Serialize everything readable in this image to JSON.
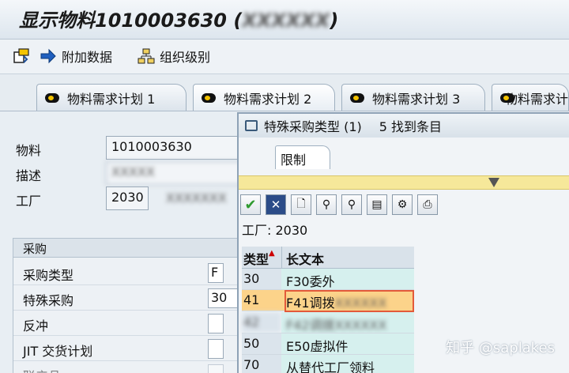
{
  "window": {
    "title": "显示物料1010003630 (",
    "title_blurred": "XXXXXX",
    "title_close": ")"
  },
  "toolbar": {
    "additional_data_label": "附加数据",
    "org_levels_label": "组织级别"
  },
  "tabs": [
    {
      "label": "物料需求计划 1"
    },
    {
      "label": "物料需求计划 2"
    },
    {
      "label": "物料需求计划 3"
    },
    {
      "label": "物料需求计"
    }
  ],
  "header_fields": {
    "material_label": "物料",
    "material_value": "1010003630",
    "description_label": "描述",
    "description_value": "XXXXX",
    "plant_label": "工厂",
    "plant_value": "2030",
    "plant_desc": "XXXXXXX"
  },
  "procurement": {
    "title": "采购",
    "rows": [
      {
        "label": "采购类型",
        "value": "F"
      },
      {
        "label": "特殊采购",
        "value": "30"
      },
      {
        "label": "反冲",
        "value": ""
      },
      {
        "label": "JIT 交货计划",
        "value": ""
      },
      {
        "label": "联产品",
        "value": ""
      }
    ]
  },
  "popup": {
    "title": "特殊采购类型 (1)",
    "count": "5 找到条目",
    "tab_label": "限制",
    "plant_line": "工厂: 2030",
    "columns": {
      "type": "类型",
      "long_text": "长文本"
    },
    "rows": [
      {
        "type": "30",
        "text": "F30委外"
      },
      {
        "type": "41",
        "text": "F41调拨",
        "blurred": "XXXXXX",
        "selected": true
      },
      {
        "type": "42",
        "text": "F42调拨",
        "blurred": "XXXXXX"
      },
      {
        "type": "50",
        "text": "E50虚拟件"
      },
      {
        "type": "70",
        "text": "从替代工厂领料"
      }
    ]
  },
  "watermark": "知乎 @saplakes",
  "colors": {
    "selection": "#fcd38a",
    "selection_border": "#e35a3a",
    "restriction_bar": "#f6e89a",
    "list_text_bg": "#d6f0ee"
  }
}
